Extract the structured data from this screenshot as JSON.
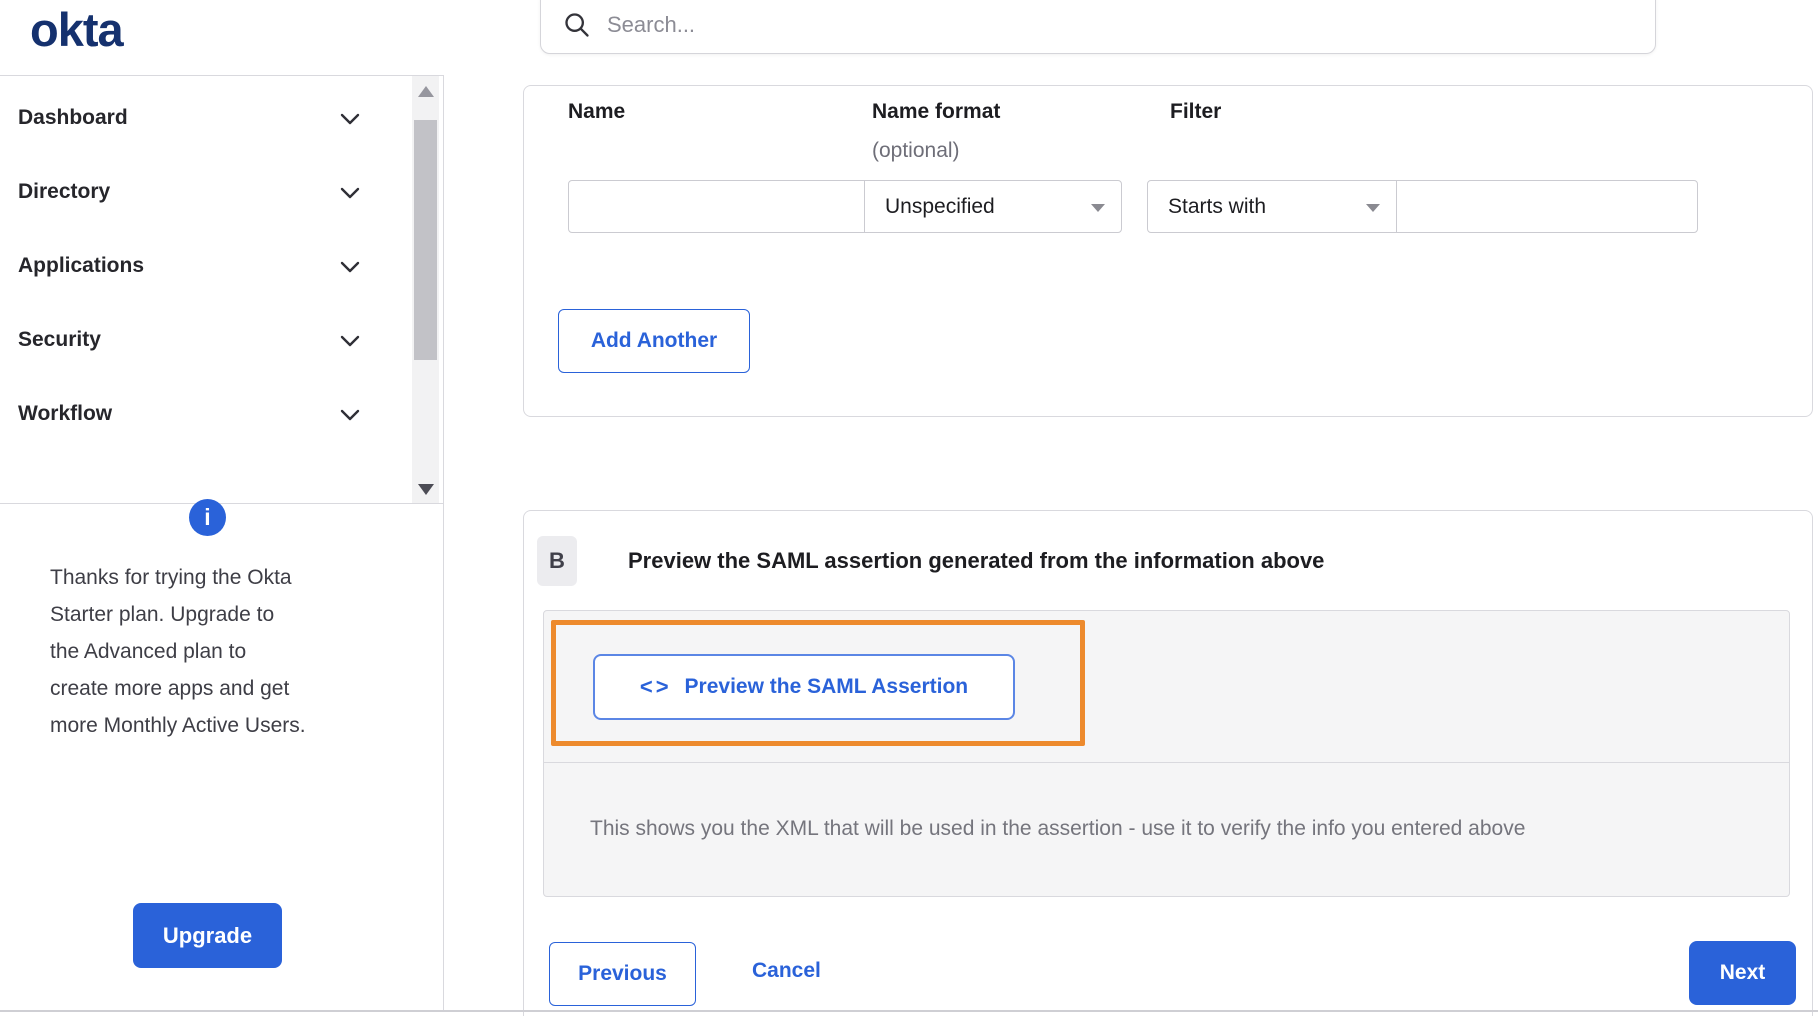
{
  "brand": {
    "logo_text": "okta"
  },
  "search": {
    "placeholder": "Search...",
    "icon": "magnifying-glass"
  },
  "sidebar": {
    "items": [
      {
        "label": "Dashboard"
      },
      {
        "label": "Directory"
      },
      {
        "label": "Applications"
      },
      {
        "label": "Security"
      },
      {
        "label": "Workflow"
      }
    ],
    "upsell": {
      "info_glyph": "i",
      "lines": [
        "Thanks for trying the Okta",
        "Starter plan. Upgrade to",
        "the Advanced plan to",
        "create more apps and get",
        "more Monthly Active Users."
      ],
      "button_label": "Upgrade"
    }
  },
  "form": {
    "labels": {
      "name": "Name",
      "name_format": "Name format",
      "name_format_note": "(optional)",
      "filter": "Filter"
    },
    "name_value": "",
    "name_format_value": "Unspecified",
    "filter_operator_value": "Starts with",
    "filter_value": "",
    "add_another_label": "Add Another"
  },
  "section_b": {
    "badge": "B",
    "title": "Preview the SAML assertion generated from the information above",
    "button_icon": "<>",
    "preview_button_label": "Preview the SAML Assertion",
    "note": "This shows you the XML that will be used in the assertion - use it to verify the info you entered above"
  },
  "footer": {
    "previous_label": "Previous",
    "cancel_label": "Cancel",
    "next_label": "Next"
  },
  "colors": {
    "accent_blue": "#2a62d9",
    "logo_navy": "#15316e",
    "annotation_orange": "#ed8a2d"
  }
}
